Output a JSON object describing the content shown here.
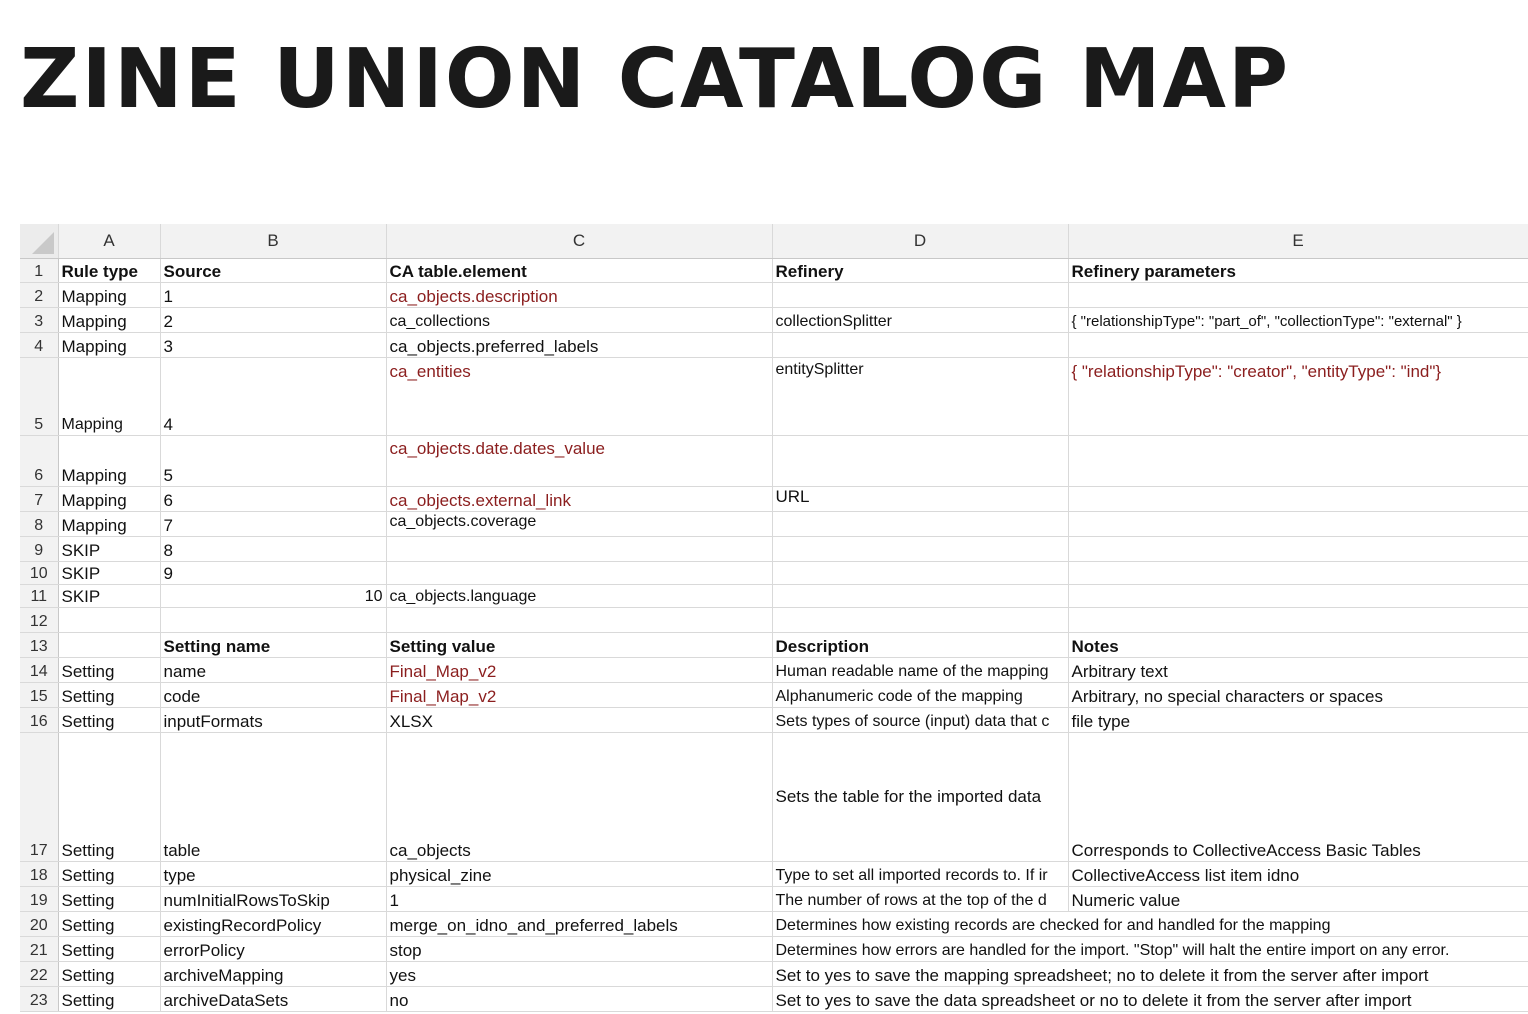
{
  "title": "ZINE UNION CATALOG MAP",
  "columns": [
    "A",
    "B",
    "C",
    "D",
    "E"
  ],
  "rows": [
    {
      "n": "1",
      "a": "Rule type",
      "b": "Source",
      "c": "CA table.element",
      "d": "Refinery",
      "e": "Refinery parameters"
    },
    {
      "n": "2",
      "a": "Mapping",
      "b": "1",
      "c": "ca_objects.description",
      "d": "",
      "e": ""
    },
    {
      "n": "3",
      "a": "Mapping",
      "b": "2",
      "c": "ca_collections",
      "d": "collectionSplitter",
      "e": "{ \"relationshipType\": \"part_of\", \"collectionType\": \"external\" }"
    },
    {
      "n": "4",
      "a": "Mapping",
      "b": "3",
      "c": "ca_objects.preferred_labels",
      "d": "",
      "e": ""
    },
    {
      "n": "5",
      "a": "Mapping",
      "b": "4",
      "c": "ca_entities",
      "d": "entitySplitter",
      "e": "{ \"relationshipType\": \"creator\", \"entityType\": \"ind\"}"
    },
    {
      "n": "6",
      "a": "Mapping",
      "b": "5",
      "c": "ca_objects.date.dates_value",
      "d": "",
      "e": ""
    },
    {
      "n": "7",
      "a": "Mapping",
      "b": "6",
      "c": "ca_objects.external_link",
      "d": "URL",
      "e": ""
    },
    {
      "n": "8",
      "a": "Mapping",
      "b": "7",
      "c": "ca_objects.coverage",
      "d": "",
      "e": ""
    },
    {
      "n": "9",
      "a": "SKIP",
      "b": "8",
      "c": "",
      "d": "",
      "e": ""
    },
    {
      "n": "10",
      "a": "SKIP",
      "b": "9",
      "c": "",
      "d": "",
      "e": ""
    },
    {
      "n": "11",
      "a": "SKIP",
      "b": "10",
      "c": "ca_objects.language",
      "d": "",
      "e": ""
    },
    {
      "n": "12",
      "a": "",
      "b": "",
      "c": "",
      "d": "",
      "e": ""
    },
    {
      "n": "13",
      "a": "",
      "b": "Setting name",
      "c": "Setting value",
      "d": "Description",
      "e": "Notes"
    },
    {
      "n": "14",
      "a": "Setting",
      "b": "name",
      "c": "Final_Map_v2",
      "d": "Human readable name of the mapping",
      "e": "Arbitrary text"
    },
    {
      "n": "15",
      "a": "Setting",
      "b": "code",
      "c": "Final_Map_v2",
      "d": "Alphanumeric code of the mapping",
      "e": "Arbitrary, no special characters or spaces"
    },
    {
      "n": "16",
      "a": "Setting",
      "b": "inputFormats",
      "c": "XLSX",
      "d": "Sets types of source (input) data that c",
      "e": "file type"
    },
    {
      "n": "17",
      "a": "Setting",
      "b": "table",
      "c": "ca_objects",
      "d": "Sets the table for the imported data",
      "e": "Corresponds to CollectiveAccess Basic Tables"
    },
    {
      "n": "18",
      "a": "Setting",
      "b": "type",
      "c": "physical_zine",
      "d": "Type to set all imported records to. If ir",
      "e": "CollectiveAccess list item idno"
    },
    {
      "n": "19",
      "a": "Setting",
      "b": "numInitialRowsToSkip",
      "c": "1",
      "d": "The number of rows at the top of the d",
      "e": "Numeric value"
    },
    {
      "n": "20",
      "a": "Setting",
      "b": "existingRecordPolicy",
      "c": "merge_on_idno_and_preferred_labels",
      "d": "Determines how existing records are checked for and handled for the mapping",
      "e": ""
    },
    {
      "n": "21",
      "a": "Setting",
      "b": "errorPolicy",
      "c": "stop",
      "d": "Determines how errors are handled for the import. \"Stop\" will halt the entire import on any error.",
      "e": ""
    },
    {
      "n": "22",
      "a": "Setting",
      "b": "archiveMapping",
      "c": "yes",
      "d": "Set to yes to save the mapping spreadsheet; no to delete it from the server after import",
      "e": ""
    },
    {
      "n": "23",
      "a": "Setting",
      "b": "archiveDataSets",
      "c": "no",
      "d": "Set to yes to save the data spreadsheet or no to delete it from the server after import",
      "e": ""
    }
  ],
  "colors": {
    "accent_text": "#8b1e1e",
    "header_bg": "#f2f2f2",
    "grid": "#d9d9d9"
  }
}
